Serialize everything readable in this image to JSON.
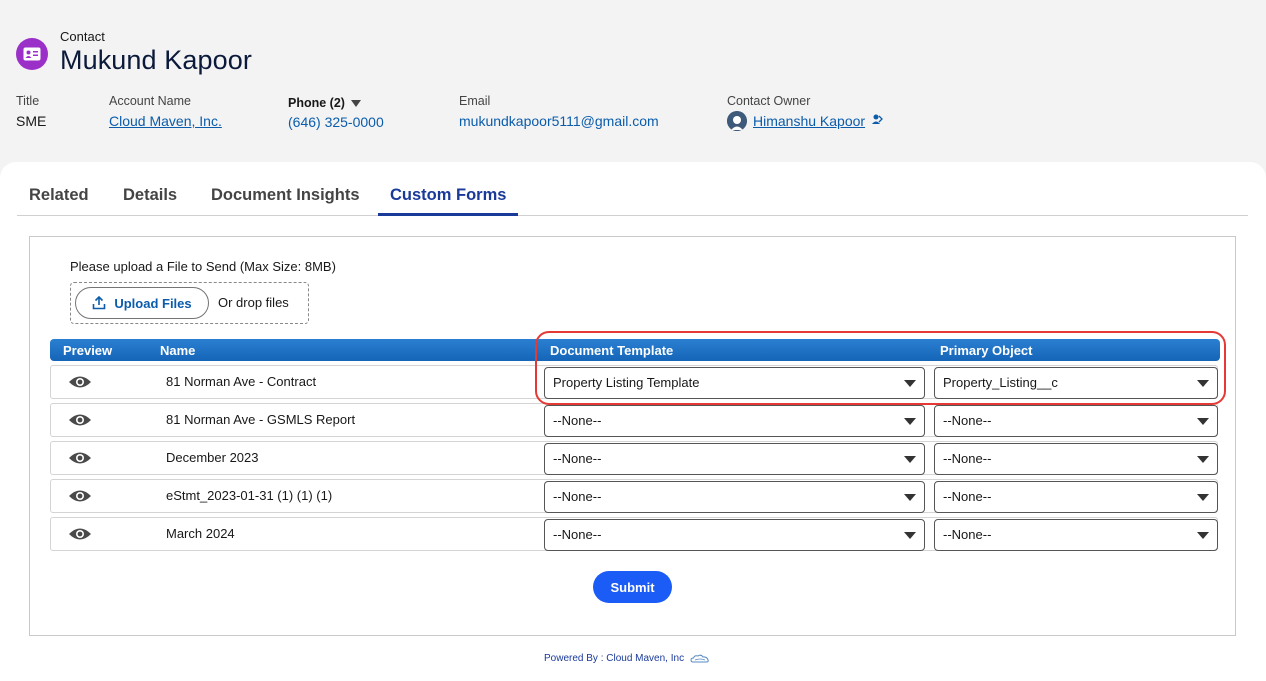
{
  "record": {
    "object_label": "Contact",
    "name": "Mukund Kapoor",
    "icon": "contact-card-icon"
  },
  "fields": {
    "title": {
      "label": "Title",
      "value": "SME"
    },
    "account": {
      "label": "Account Name",
      "value": "Cloud Maven, Inc."
    },
    "phone": {
      "label": "Phone (2)",
      "value": "(646) 325-0000"
    },
    "email": {
      "label": "Email",
      "value": "mukundkapoor5111@gmail.com"
    },
    "owner": {
      "label": "Contact Owner",
      "value": "Himanshu Kapoor"
    }
  },
  "tabs": [
    {
      "label": "Related",
      "active": false
    },
    {
      "label": "Details",
      "active": false
    },
    {
      "label": "Document Insights",
      "active": false
    },
    {
      "label": "Custom Forms",
      "active": true
    }
  ],
  "upload": {
    "label": "Please upload a File to Send (Max Size: 8MB)",
    "button": "Upload Files",
    "drop_text": "Or drop files"
  },
  "grid": {
    "headers": {
      "preview": "Preview",
      "name": "Name",
      "template": "Document Template",
      "object": "Primary Object"
    },
    "rows": [
      {
        "name": "81 Norman Ave - Contract",
        "template": "Property Listing Template",
        "object": "Property_Listing__c"
      },
      {
        "name": "81 Norman Ave - GSMLS Report",
        "template": "--None--",
        "object": "--None--"
      },
      {
        "name": "December 2023",
        "template": "--None--",
        "object": "--None--"
      },
      {
        "name": "eStmt_2023-01-31 (1) (1) (1)",
        "template": "--None--",
        "object": "--None--"
      },
      {
        "name": "March 2024",
        "template": "--None--",
        "object": "--None--"
      }
    ]
  },
  "submit_label": "Submit",
  "footer": "Powered By : Cloud Maven, Inc",
  "colors": {
    "accent": "#1b5cf7",
    "highlight": "#e53935",
    "grid_header": "#1f72c6",
    "object_icon": "#9b30c9"
  }
}
